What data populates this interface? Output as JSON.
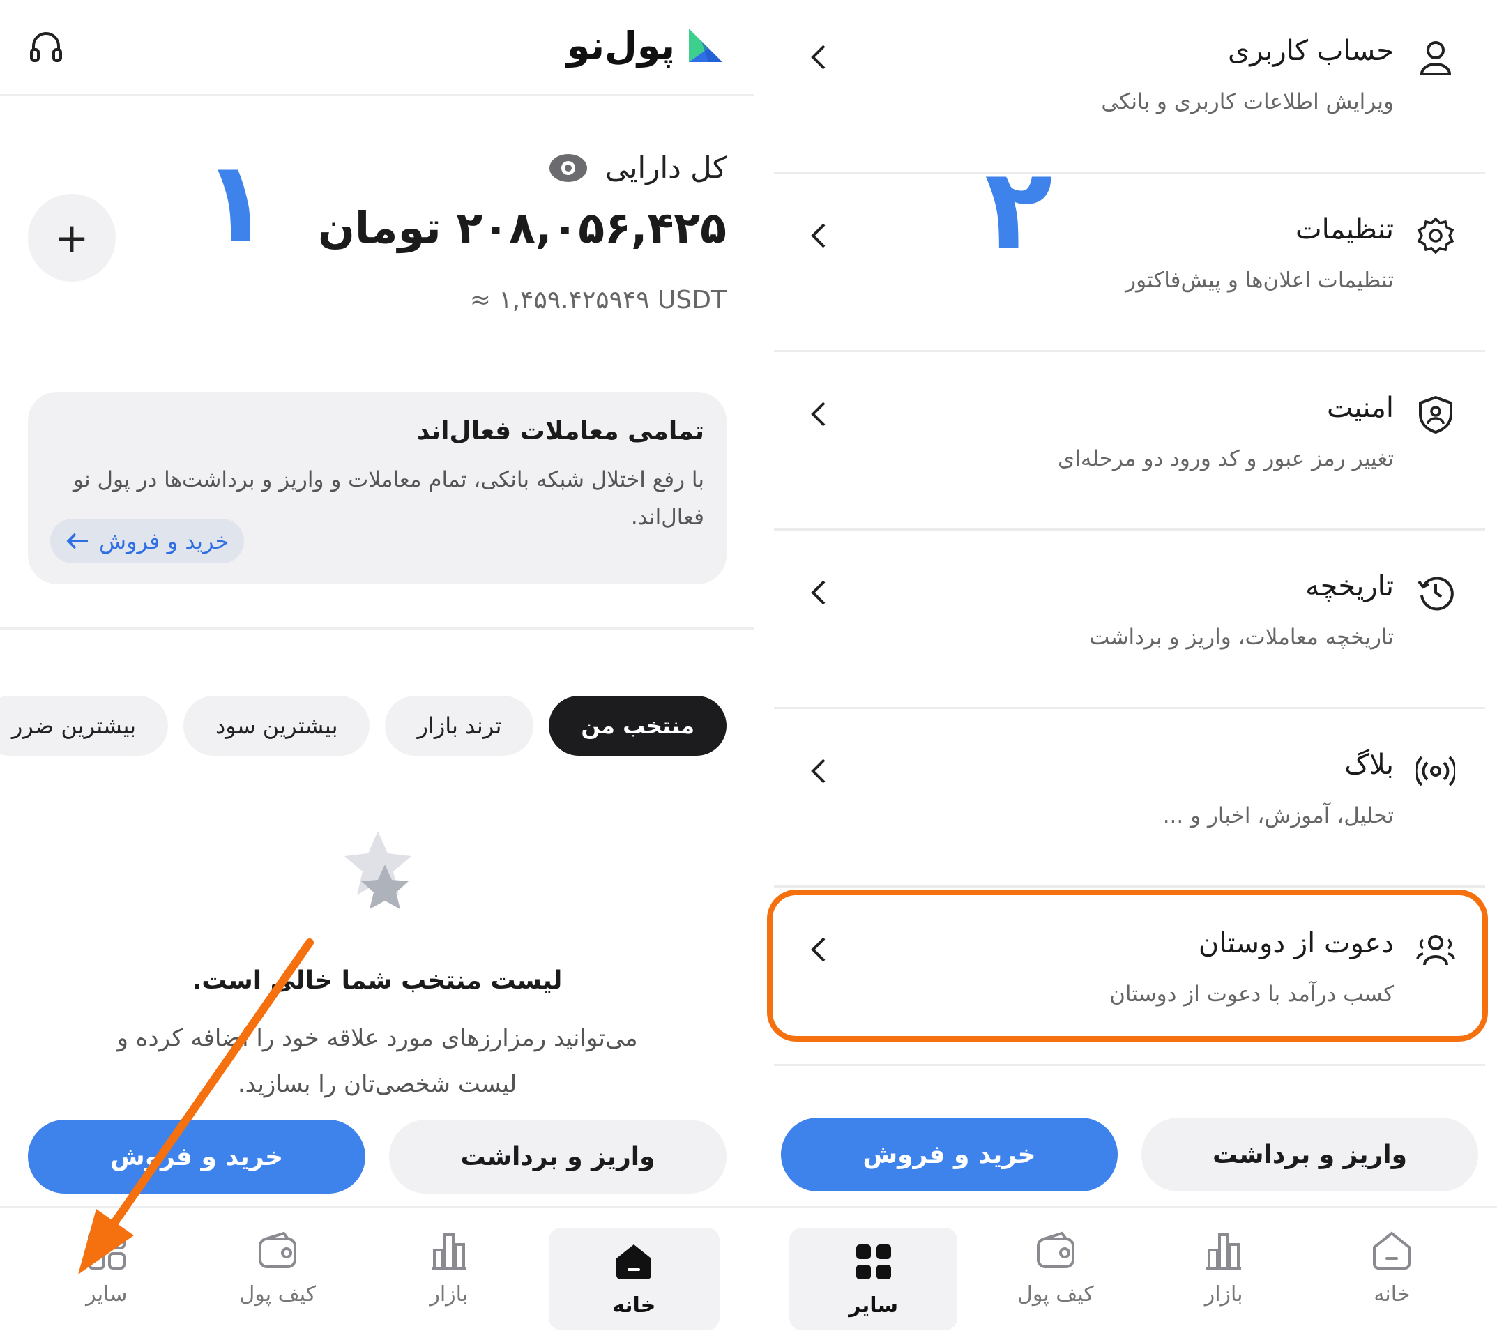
{
  "left": {
    "brand": "پول‌نو",
    "total_label": "کل دارایی",
    "total_amount": "۲۰۸,۰۵۶,۴۲۵ تومان",
    "total_usdt": "≈ ۱,۴۵۹.۴۲۵۹۴۹ USDT",
    "step_number": "۱",
    "notice": {
      "title": "تمامی معاملات فعال‌اند",
      "body": "با رفع اختلال شبکه بانکی، تمام معاملات و واریز و برداشت‌ها در پول نو فعال‌اند.",
      "button": "خرید و فروش"
    },
    "chips": [
      "منتخب من",
      "ترند بازار",
      "بیشترین سود",
      "بیشترین ضرر"
    ],
    "empty": {
      "title": "لیست منتخب شما خالی است.",
      "desc": "می‌توانید رمزارزهای مورد علاقه خود را اضافه کرده و لیست شخصی‌تان را بسازید."
    },
    "actions": {
      "deposit": "واریز و برداشت",
      "trade": "خرید و فروش"
    },
    "nav": [
      "خانه",
      "بازار",
      "کیف پول",
      "سایر"
    ]
  },
  "right": {
    "step_number": "۲",
    "menu": [
      {
        "title": "حساب کاربری",
        "sub": "ویرایش اطلاعات کاربری و بانکی",
        "icon": "user-icon"
      },
      {
        "title": "تنظیمات",
        "sub": "تنظیمات اعلان‌ها و پیش‌فاکتور",
        "icon": "gear-icon"
      },
      {
        "title": "امنیت",
        "sub": "تغییر رمز عبور و کد ورود دو مرحله‌ای",
        "icon": "shield-user-icon"
      },
      {
        "title": "تاریخچه",
        "sub": "تاریخچه معاملات، واریز و برداشت",
        "icon": "history-icon"
      },
      {
        "title": "بلاگ",
        "sub": "تحلیل، آموزش، اخبار و ...",
        "icon": "broadcast-icon"
      },
      {
        "title": "دعوت از دوستان",
        "sub": "کسب درآمد با دعوت از دوستان",
        "icon": "users-icon"
      }
    ],
    "actions": {
      "deposit": "واریز و برداشت",
      "trade": "خرید و فروش"
    },
    "nav": [
      "خانه",
      "بازار",
      "کیف پول",
      "سایر"
    ]
  },
  "colors": {
    "primary": "#3e82ec",
    "highlight": "#f5700f",
    "dark": "#1c1c1e"
  }
}
